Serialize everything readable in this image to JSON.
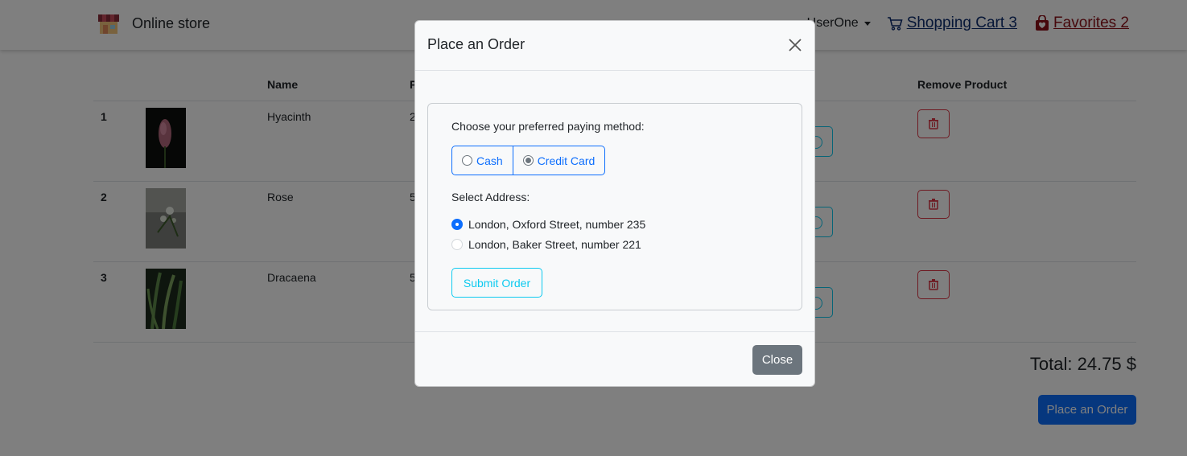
{
  "navbar": {
    "brand": "Online store",
    "user": "UserOne",
    "cart_label": "Shopping Cart 3",
    "favorites_label": "Favorites 2"
  },
  "table": {
    "headers": [
      "Name",
      "P",
      "Remove Product"
    ],
    "rows": [
      {
        "index": "1",
        "name": "Hyacinth",
        "price": "2"
      },
      {
        "index": "2",
        "name": "Rose",
        "price": "5"
      },
      {
        "index": "3",
        "name": "Dracaena",
        "price": "5"
      }
    ]
  },
  "total": "Total: 24.75 $",
  "place_order_button": "Place an Order",
  "modal": {
    "title": "Place an Order",
    "paying_method_label": "Choose your preferred paying method:",
    "pay_options": [
      {
        "label": "Cash",
        "selected": false
      },
      {
        "label": "Credit Card",
        "selected": true
      }
    ],
    "address_label": "Select Address:",
    "addresses": [
      {
        "label": "London, Oxford Street, number 235",
        "selected": true
      },
      {
        "label": "London, Baker Street, number 221",
        "selected": false
      }
    ],
    "submit_button": "Submit Order",
    "close_button": "Close"
  },
  "colors": {
    "primary": "#0d6efd",
    "info": "#0dcaf0",
    "danger": "#dc3545",
    "secondary": "#6c757d",
    "cart_link": "#0d2d6e",
    "favorites_link": "#8c1018"
  }
}
